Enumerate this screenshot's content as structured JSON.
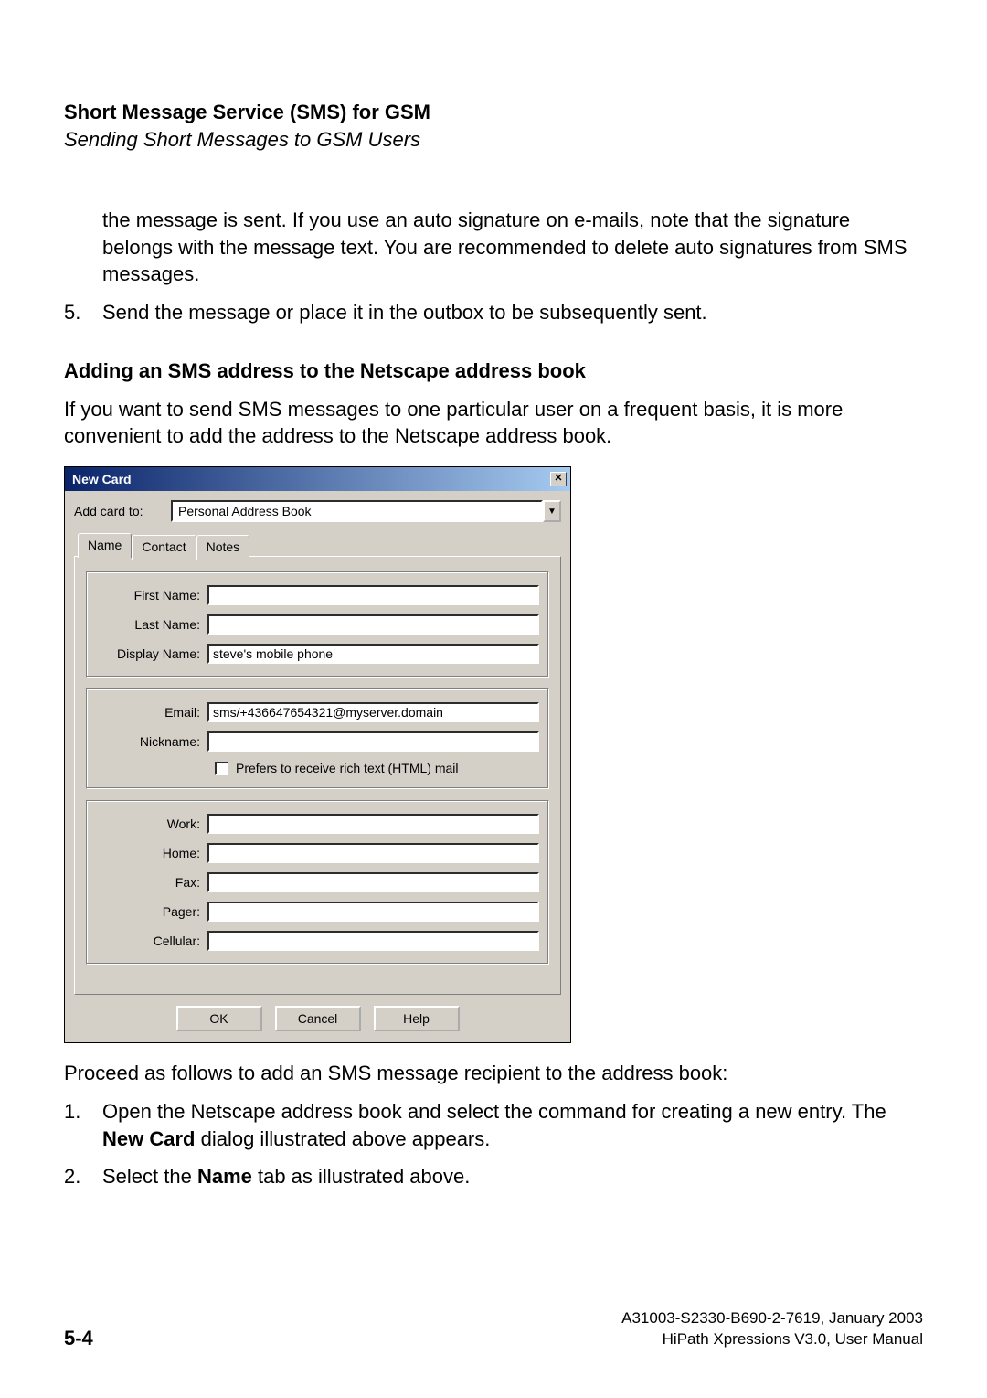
{
  "header": {
    "title": "Short Message Service (SMS) for GSM",
    "subtitle": "Sending Short Messages to GSM Users"
  },
  "intro_para": "the message is sent. If you use an auto signature on e-mails, note that the signature belongs with the message text. You are recommended to delete auto signatures from SMS messages.",
  "step5_num": "5.",
  "step5_text": "Send the message or place it in the outbox to be subsequently sent.",
  "section_heading": "Adding an SMS address to the Netscape address book",
  "section_para": "If you want to send SMS messages to one particular user on a frequent basis, it is more convenient to add the address to the Netscape address book.",
  "dialog": {
    "title": "New Card",
    "close_glyph": "✕",
    "add_card_to_label": "Add card to:",
    "add_card_to_value": "Personal Address Book",
    "combo_arrow": "▼",
    "tabs": {
      "name": "Name",
      "contact": "Contact",
      "notes": "Notes"
    },
    "fields": {
      "first_name_label": "First Name:",
      "first_name_value": "",
      "last_name_label": "Last Name:",
      "last_name_value": "",
      "display_name_label": "Display Name:",
      "display_name_value": "steve's mobile phone",
      "email_label": "Email:",
      "email_value": "sms/+436647654321@myserver.domain",
      "nickname_label": "Nickname:",
      "nickname_value": "",
      "prefers_label": "Prefers to receive rich text (HTML) mail",
      "work_label": "Work:",
      "work_value": "",
      "home_label": "Home:",
      "home_value": "",
      "fax_label": "Fax:",
      "fax_value": "",
      "pager_label": "Pager:",
      "pager_value": "",
      "cellular_label": "Cellular:",
      "cellular_value": ""
    },
    "buttons": {
      "ok": "OK",
      "cancel": "Cancel",
      "help": "Help"
    }
  },
  "proceed_text": "Proceed as follows to add an SMS message recipient to the address book:",
  "steps": {
    "s1_num": "1.",
    "s1_a": "Open the Netscape address book and select the command for creating a new entry. The ",
    "s1_b": "New Card",
    "s1_c": " dialog illustrated above appears.",
    "s2_num": "2.",
    "s2_a": "Select the ",
    "s2_b": "Name",
    "s2_c": " tab as illustrated above."
  },
  "footer": {
    "page": "5-4",
    "line1": "A31003-S2330-B690-2-7619, January 2003",
    "line2": "HiPath Xpressions V3.0, User Manual"
  }
}
